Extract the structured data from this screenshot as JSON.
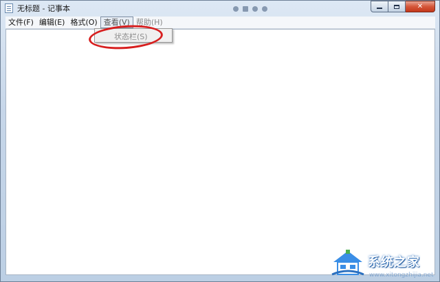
{
  "window": {
    "title": "无标题 - 记事本"
  },
  "menubar": {
    "items": [
      {
        "label": "文件(F)"
      },
      {
        "label": "编辑(E)"
      },
      {
        "label": "格式(O)"
      },
      {
        "label": "查看(V)"
      },
      {
        "label": "帮助(H)"
      }
    ]
  },
  "dropdown": {
    "items": [
      {
        "label": "状态栏(S)",
        "enabled": false
      }
    ]
  },
  "editor": {
    "content": ""
  },
  "watermark": {
    "text": "系统之家",
    "url": "www.xitongzhijia.net"
  },
  "icons": {
    "app": "notepad-icon",
    "minimize": "minimize-icon",
    "maximize": "maximize-icon",
    "close": "close-icon",
    "watermark_logo": "house-logo-icon"
  },
  "colors": {
    "annotation": "#d71e1e",
    "close_button": "#c3371a",
    "watermark_blue": "#2a6fbf"
  }
}
